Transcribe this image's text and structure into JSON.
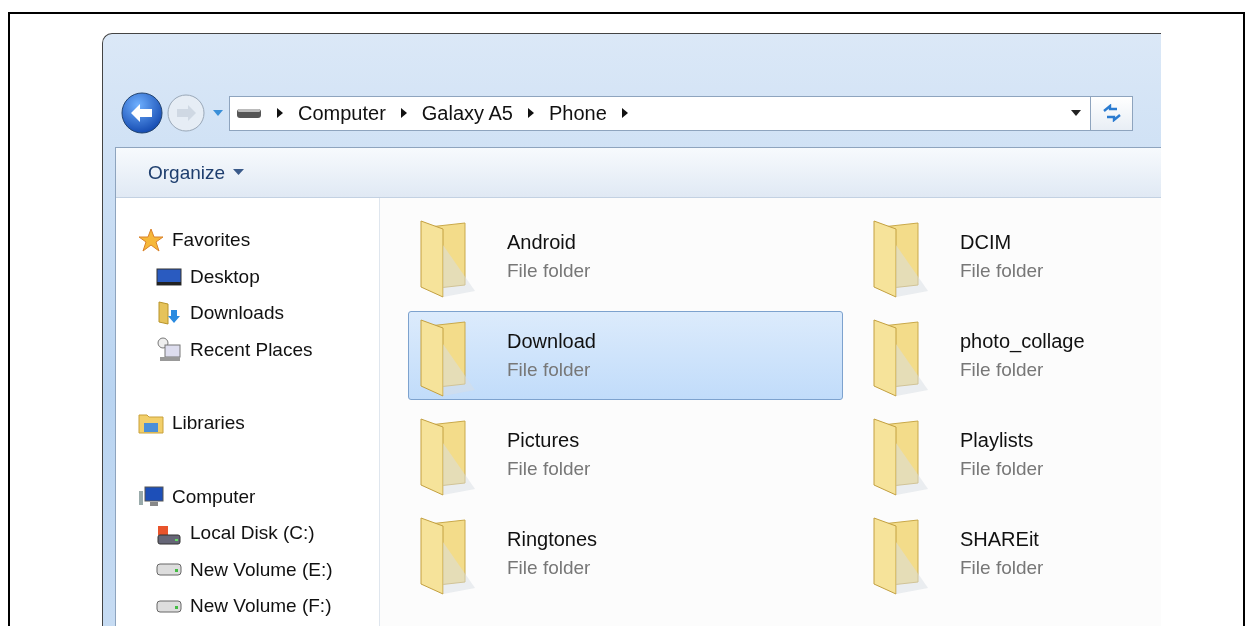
{
  "address": {
    "crumbs": [
      "Computer",
      "Galaxy A5",
      "Phone"
    ]
  },
  "toolbar": {
    "organize": "Organize"
  },
  "sidebar": {
    "groups": [
      {
        "label": "Favorites",
        "kind": "star",
        "children": [
          {
            "label": "Desktop",
            "kind": "desktop"
          },
          {
            "label": "Downloads",
            "kind": "downloads"
          },
          {
            "label": "Recent Places",
            "kind": "recent"
          }
        ]
      },
      {
        "label": "Libraries",
        "kind": "libraries"
      },
      {
        "label": "Computer",
        "kind": "computer",
        "children": [
          {
            "label": "Local Disk (C:)",
            "kind": "system-disk"
          },
          {
            "label": "New Volume (E:)",
            "kind": "drive"
          },
          {
            "label": "New Volume (F:)",
            "kind": "drive"
          }
        ]
      }
    ]
  },
  "folders": [
    {
      "name": "Android",
      "type": "File folder",
      "selected": false
    },
    {
      "name": "DCIM",
      "type": "File folder",
      "selected": false
    },
    {
      "name": "Download",
      "type": "File folder",
      "selected": true
    },
    {
      "name": "photo_collage",
      "type": "File folder",
      "selected": false
    },
    {
      "name": "Pictures",
      "type": "File folder",
      "selected": false
    },
    {
      "name": "Playlists",
      "type": "File folder",
      "selected": false
    },
    {
      "name": "Ringtones",
      "type": "File folder",
      "selected": false
    },
    {
      "name": "SHAREit",
      "type": "File folder",
      "selected": false
    }
  ]
}
